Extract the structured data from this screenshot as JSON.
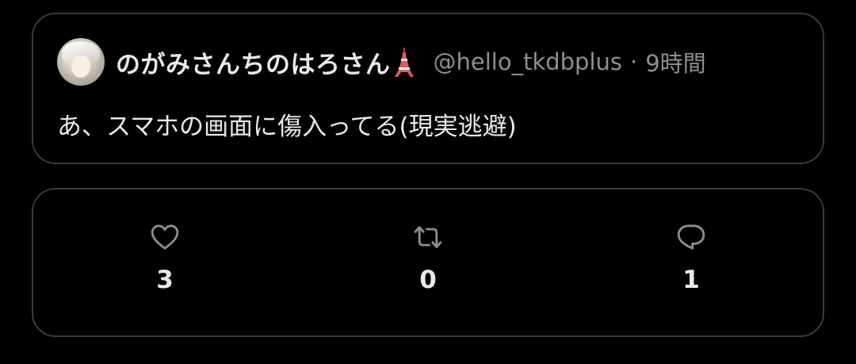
{
  "tweet": {
    "display_name": "のがみさんちのはろさん",
    "name_emoji_icon": "tokyo-tower-icon",
    "handle": "@hello_tkdbplus",
    "separator": "·",
    "time": "9時間",
    "text": "あ、スマホの画面に傷入ってる(現実逃避)"
  },
  "stats": {
    "likes": {
      "icon": "heart-icon",
      "count": "3"
    },
    "retweets": {
      "icon": "retweet-icon",
      "count": "0"
    },
    "replies": {
      "icon": "reply-icon",
      "count": "1"
    }
  },
  "colors": {
    "background": "#000000",
    "border": "#3a3a3a",
    "primary_text": "#e7e9ea",
    "secondary_text": "#8b8f94",
    "icon": "#8b8f94"
  }
}
